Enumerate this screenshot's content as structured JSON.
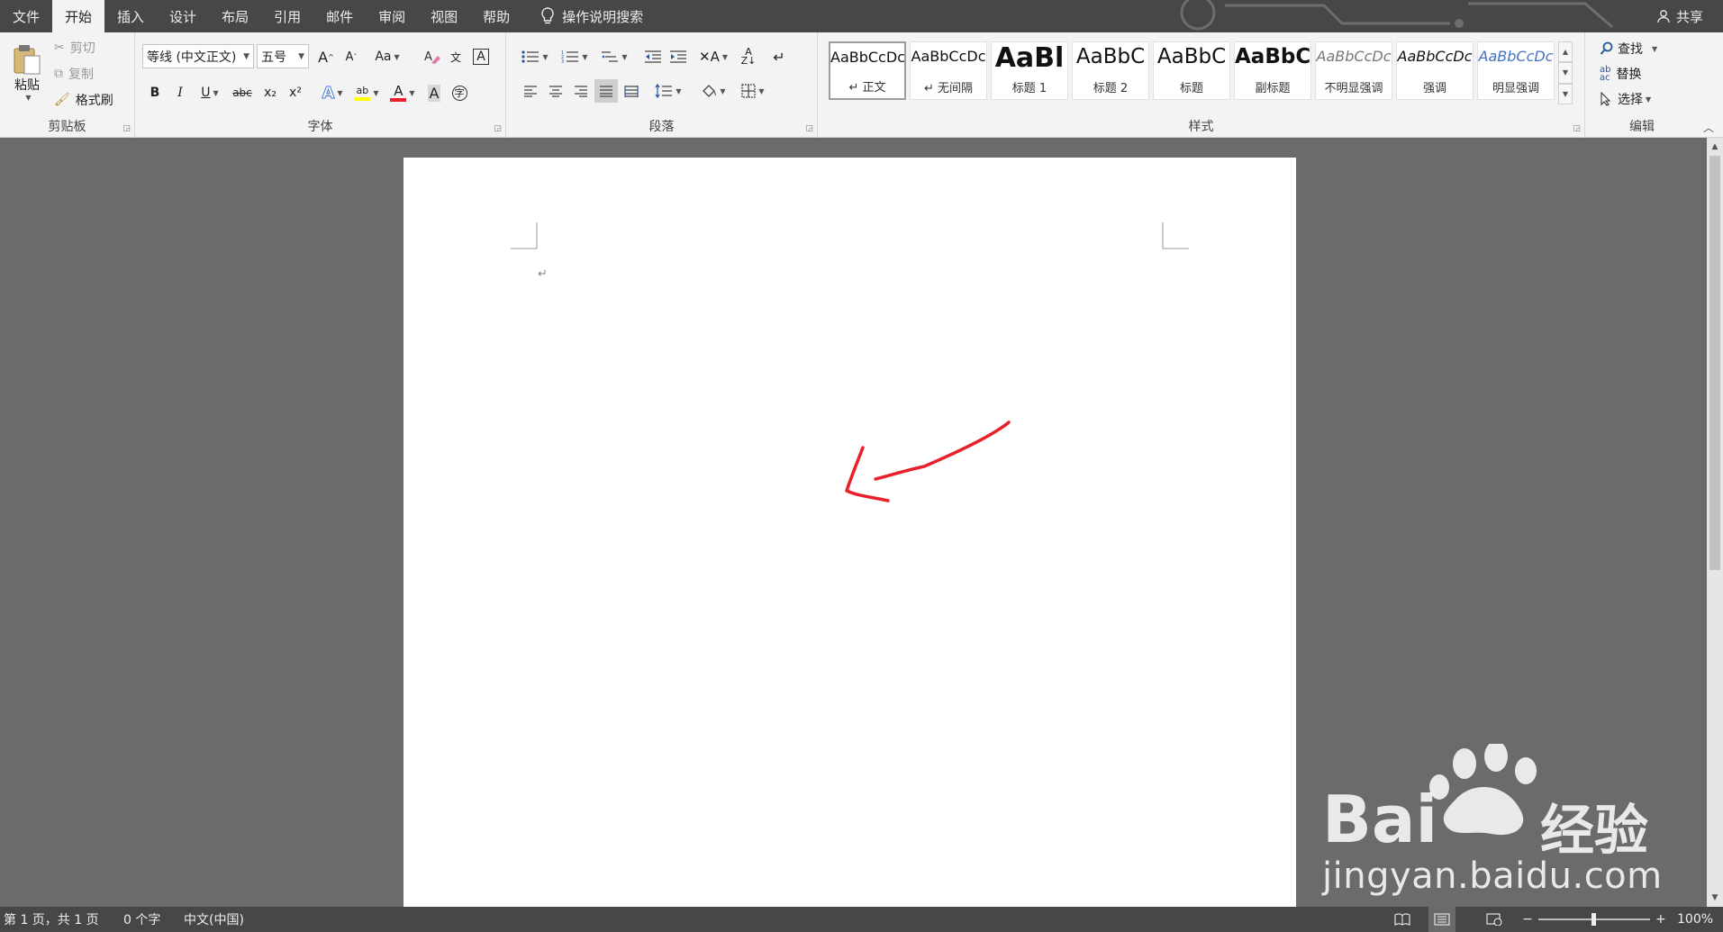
{
  "menubar": {
    "tabs": [
      "文件",
      "开始",
      "插入",
      "设计",
      "布局",
      "引用",
      "邮件",
      "审阅",
      "视图",
      "帮助"
    ],
    "active_tab": "开始",
    "tell_me": "操作说明搜索",
    "share": "共享"
  },
  "ribbon": {
    "clipboard": {
      "label": "剪贴板",
      "paste": "粘贴",
      "cut": "剪切",
      "copy": "复制",
      "format_painter": "格式刷"
    },
    "font": {
      "label": "字体",
      "font_name": "等线 (中文正文)",
      "font_size": "五号",
      "change_case": "Aa",
      "bold": "B",
      "italic": "I",
      "underline": "U",
      "strikethrough": "abc",
      "subscript": "x₂",
      "superscript": "x²",
      "font_color_letter": "A",
      "char_shading": "A"
    },
    "paragraph": {
      "label": "段落"
    },
    "styles": {
      "label": "样式",
      "items": [
        {
          "sample": "AaBbCcDc",
          "name": "↵ 正文"
        },
        {
          "sample": "AaBbCcDc",
          "name": "↵ 无间隔"
        },
        {
          "sample": "AaBl",
          "name": "标题 1"
        },
        {
          "sample": "AaBbC",
          "name": "标题 2"
        },
        {
          "sample": "AaBbC",
          "name": "标题"
        },
        {
          "sample": "AaBbC",
          "name": "副标题"
        },
        {
          "sample": "AaBbCcDc",
          "name": "不明显强调"
        },
        {
          "sample": "AaBbCcDc",
          "name": "强调"
        },
        {
          "sample": "AaBbCcDc",
          "name": "明显强调"
        }
      ]
    },
    "editing": {
      "label": "编辑",
      "find": "查找",
      "replace": "替换",
      "select": "选择"
    }
  },
  "document": {
    "paragraph_mark": "↵",
    "annotation_color": "#e8202a"
  },
  "statusbar": {
    "page": "第 1 页，共 1 页",
    "words": "0 个字",
    "language": "中文(中国)",
    "zoom": "100%"
  },
  "watermark": {
    "brand": "Bai",
    "brand_cn": "经验",
    "url": "jingyan.baidu.com"
  },
  "colors": {
    "menubar": "#474747",
    "ribbon": "#f3f3f3",
    "canvas": "#6b6b6b",
    "page": "#ffffff",
    "highlight": "#ffff00",
    "font_color": "#e8202a"
  }
}
